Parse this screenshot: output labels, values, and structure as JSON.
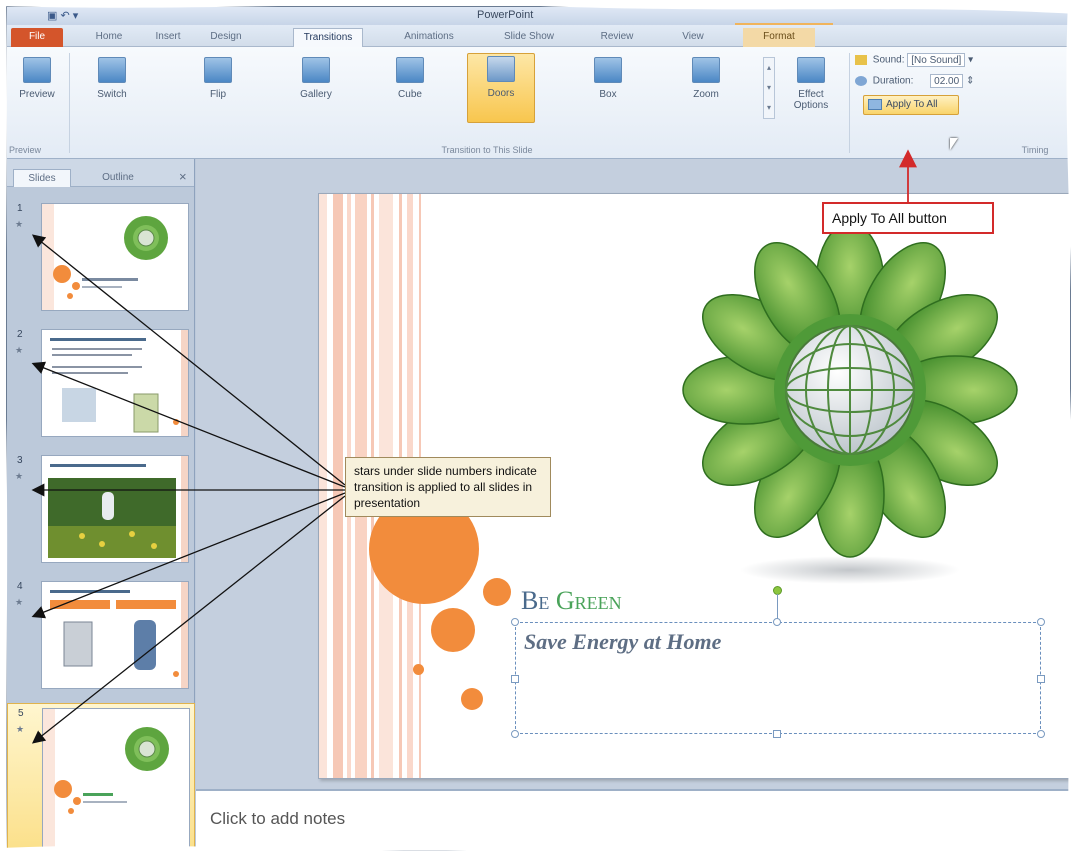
{
  "window": {
    "title": "PowerPoint"
  },
  "tabs": [
    "File",
    "Home",
    "Insert",
    "Design",
    "Transitions",
    "Animations",
    "Slide Show",
    "Review",
    "View",
    "Format"
  ],
  "ribbon": {
    "preview": {
      "button_label": "Preview",
      "group_label": "Preview"
    },
    "transitions": [
      "Switch",
      "Flip",
      "Gallery",
      "Cube",
      "Doors",
      "Box",
      "Zoom"
    ],
    "selected_transition": "Doors",
    "effect_options_label": "Effect Options",
    "group_label": "Transition to This Slide",
    "timing": {
      "sound_label": "Sound:",
      "sound_value": "[No Sound]",
      "duration_label": "Duration:",
      "duration_value": "02.00",
      "apply_all_label": "Apply To All",
      "group_label": "Timing"
    }
  },
  "slides_pane": {
    "tabs": [
      "Slides",
      "Outline"
    ],
    "close_glyph": "×",
    "slides": [
      {
        "number": "1"
      },
      {
        "number": "2"
      },
      {
        "number": "3"
      },
      {
        "number": "4"
      },
      {
        "number": "5"
      }
    ],
    "star_glyph": "★",
    "current_slide": "5"
  },
  "slide": {
    "title_part1": "Be ",
    "title_part2": "Green",
    "subtitle": "Save Energy at Home"
  },
  "notes": {
    "placeholder": "Click to add notes"
  },
  "callouts": {
    "apply_all": "Apply To All button",
    "stars": "stars under slide numbers indicate transition is applied to all slides in presentation"
  },
  "colors": {
    "accent_orange": "#f28c3c",
    "callout_red": "#d32a2a",
    "file_tab": "#d4552b",
    "flower_green": "#4aa35a"
  }
}
